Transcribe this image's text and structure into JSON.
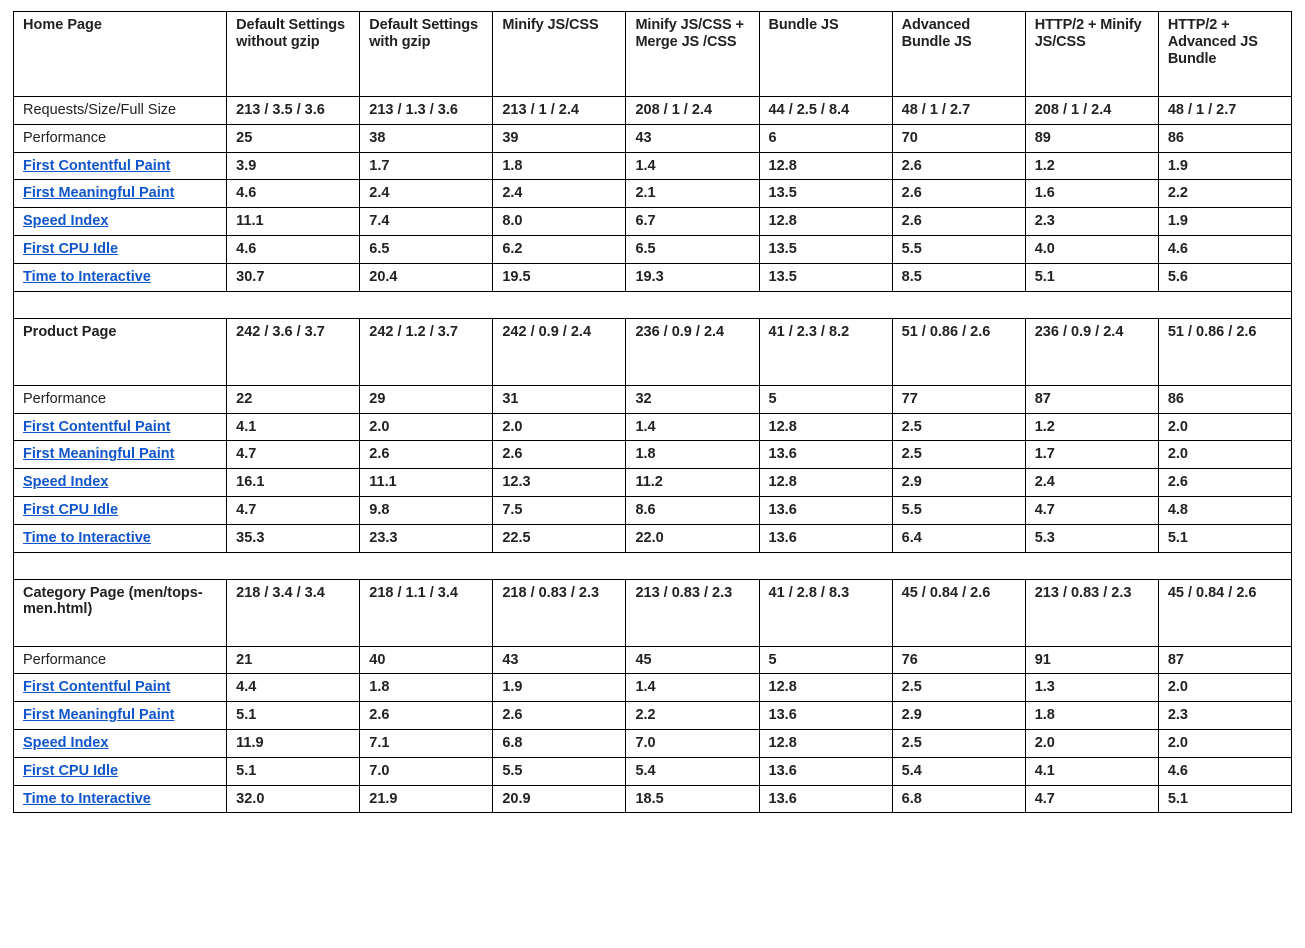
{
  "colors": {
    "good": "#1e7b3c",
    "average": "#e08214",
    "poor": "#b42f28",
    "neutral": "#1a1a1a",
    "link": "#1155cc",
    "border": "#000000"
  },
  "columns": [
    "Default Settings without  gzip",
    "Default Settings with gzip",
    "Minify JS/CSS",
    "Minify JS/CSS + Merge JS /CSS",
    "Bundle JS",
    "Advanced Bundle JS",
    "HTTP/2 + Minify JS/CSS",
    "HTTP/2 + Advanced JS Bundle"
  ],
  "blocks": [
    {
      "title": "Home Page",
      "header_kind": "columns",
      "rows": [
        {
          "label": "Requests/Size/Full Size",
          "label_style": "plain",
          "cells": [
            {
              "text": "213 / 3.5 / 3.6",
              "color": "neutral"
            },
            {
              "text": "213 / 1.3 / 3.6",
              "color": "neutral"
            },
            {
              "text": "213 / 1 / 2.4",
              "color": "neutral"
            },
            {
              "text": "208 / 1 / 2.4",
              "color": "neutral"
            },
            {
              "text": "44 / 2.5 / 8.4",
              "color": "neutral"
            },
            {
              "text": "48 / 1 / 2.7",
              "color": "neutral"
            },
            {
              "text": "208 / 1 / 2.4",
              "color": "neutral"
            },
            {
              "text": "48 / 1 / 2.7",
              "color": "neutral"
            }
          ]
        },
        {
          "label": "Performance",
          "label_style": "plain",
          "cells": [
            {
              "text": "25",
              "color": "neutral"
            },
            {
              "text": "38",
              "color": "neutral"
            },
            {
              "text": "39",
              "color": "neutral"
            },
            {
              "text": "43",
              "color": "neutral"
            },
            {
              "text": "6",
              "color": "neutral"
            },
            {
              "text": "70",
              "color": "neutral"
            },
            {
              "text": "89",
              "color": "neutral"
            },
            {
              "text": "86",
              "color": "neutral"
            }
          ]
        },
        {
          "label": "First Contentful Paint",
          "label_style": "link",
          "cells": [
            {
              "text": "3.9",
              "color": "average"
            },
            {
              "text": "1.7",
              "color": "good"
            },
            {
              "text": "1.8",
              "color": "good"
            },
            {
              "text": "1.4",
              "color": "good"
            },
            {
              "text": "12.8",
              "color": "poor"
            },
            {
              "text": "2.6",
              "color": "average"
            },
            {
              "text": "1.2",
              "color": "good"
            },
            {
              "text": "1.9",
              "color": "good"
            }
          ]
        },
        {
          "label": "First Meaningful Paint",
          "label_style": "link",
          "cells": [
            {
              "text": "4.6",
              "color": "poor"
            },
            {
              "text": "2.4",
              "color": "average"
            },
            {
              "text": "2.4",
              "color": "average"
            },
            {
              "text": "2.1",
              "color": "good"
            },
            {
              "text": "13.5",
              "color": "poor"
            },
            {
              "text": "2.6",
              "color": "average"
            },
            {
              "text": "1.6",
              "color": "good"
            },
            {
              "text": "2.2",
              "color": "good"
            }
          ]
        },
        {
          "label": "Speed Index",
          "label_style": "link",
          "cells": [
            {
              "text": "11.1",
              "color": "poor"
            },
            {
              "text": "7.4",
              "color": "poor"
            },
            {
              "text": "8.0",
              "color": "poor"
            },
            {
              "text": "6.7",
              "color": "poor"
            },
            {
              "text": "12.8",
              "color": "poor"
            },
            {
              "text": "2.6",
              "color": "good"
            },
            {
              "text": "2.3",
              "color": "good"
            },
            {
              "text": "1.9",
              "color": "good"
            }
          ]
        },
        {
          "label": "First CPU Idle",
          "label_style": "link",
          "cells": [
            {
              "text": "4.6",
              "color": "average"
            },
            {
              "text": "6.5",
              "color": "average"
            },
            {
              "text": "6.2",
              "color": "average"
            },
            {
              "text": "6.5",
              "color": "poor"
            },
            {
              "text": "13.5",
              "color": "poor"
            },
            {
              "text": "5.5",
              "color": "average"
            },
            {
              "text": "4.0",
              "color": "average"
            },
            {
              "text": "4.6",
              "color": "average"
            }
          ]
        },
        {
          "label": "Time to Interactive",
          "label_style": "link",
          "cells": [
            {
              "text": "30.7",
              "color": "poor"
            },
            {
              "text": "20.4",
              "color": "poor"
            },
            {
              "text": "19.5",
              "color": "poor"
            },
            {
              "text": "19.3",
              "color": "poor"
            },
            {
              "text": "13.5",
              "color": "poor"
            },
            {
              "text": "8.5",
              "color": "poor"
            },
            {
              "text": "5.1",
              "color": "average"
            },
            {
              "text": "5.6",
              "color": "average"
            }
          ]
        }
      ]
    },
    {
      "title": "Product Page",
      "header_kind": "summary",
      "header_cells": [
        "242 / 3.6 / 3.7",
        "242 / 1.2 / 3.7",
        "242 / 0.9 / 2.4",
        "236 / 0.9 / 2.4",
        "41 / 2.3 / 8.2",
        "51 / 0.86 / 2.6",
        "236 / 0.9 / 2.4",
        "51 / 0.86 / 2.6"
      ],
      "rows": [
        {
          "label": "Performance",
          "label_style": "plain",
          "cells": [
            {
              "text": "22",
              "color": "neutral"
            },
            {
              "text": "29",
              "color": "neutral"
            },
            {
              "text": "31",
              "color": "neutral"
            },
            {
              "text": "32",
              "color": "neutral"
            },
            {
              "text": "5",
              "color": "neutral"
            },
            {
              "text": "77",
              "color": "neutral"
            },
            {
              "text": "87",
              "color": "neutral"
            },
            {
              "text": "86",
              "color": "neutral"
            }
          ]
        },
        {
          "label": "First Contentful Paint",
          "label_style": "link",
          "cells": [
            {
              "text": "4.1",
              "color": "poor"
            },
            {
              "text": "2.0",
              "color": "good"
            },
            {
              "text": "2.0",
              "color": "good"
            },
            {
              "text": "1.4",
              "color": "good"
            },
            {
              "text": "12.8",
              "color": "poor"
            },
            {
              "text": "2.5",
              "color": "average"
            },
            {
              "text": "1.2",
              "color": "good"
            },
            {
              "text": "2.0",
              "color": "good"
            }
          ]
        },
        {
          "label": "First Meaningful Paint",
          "label_style": "link",
          "cells": [
            {
              "text": "4.7",
              "color": "poor"
            },
            {
              "text": "2.6",
              "color": "average"
            },
            {
              "text": "2.6",
              "color": "average"
            },
            {
              "text": "1.8",
              "color": "good"
            },
            {
              "text": "13.6",
              "color": "poor"
            },
            {
              "text": "2.5",
              "color": "average"
            },
            {
              "text": "1.7",
              "color": "good"
            },
            {
              "text": "2.0",
              "color": "good"
            }
          ]
        },
        {
          "label": "Speed Index",
          "label_style": "link",
          "cells": [
            {
              "text": "16.1",
              "color": "poor"
            },
            {
              "text": "11.1",
              "color": "poor"
            },
            {
              "text": "12.3",
              "color": "poor"
            },
            {
              "text": "11.2",
              "color": "poor"
            },
            {
              "text": "12.8",
              "color": "poor"
            },
            {
              "text": "2.9",
              "color": "good"
            },
            {
              "text": "2.4",
              "color": "good"
            },
            {
              "text": "2.6",
              "color": "good"
            }
          ]
        },
        {
          "label": "First CPU Idle",
          "label_style": "link",
          "cells": [
            {
              "text": "4.7",
              "color": "average"
            },
            {
              "text": "9.8",
              "color": "poor"
            },
            {
              "text": "7.5",
              "color": "poor"
            },
            {
              "text": "8.6",
              "color": "poor"
            },
            {
              "text": "13.6",
              "color": "poor"
            },
            {
              "text": "5.5",
              "color": "average"
            },
            {
              "text": "4.7",
              "color": "average"
            },
            {
              "text": "4.8",
              "color": "average"
            }
          ]
        },
        {
          "label": "Time to Interactive",
          "label_style": "link",
          "cells": [
            {
              "text": "35.3",
              "color": "poor"
            },
            {
              "text": "23.3",
              "color": "poor"
            },
            {
              "text": "22.5",
              "color": "poor"
            },
            {
              "text": "22.0",
              "color": "poor"
            },
            {
              "text": "13.6",
              "color": "poor"
            },
            {
              "text": "6.4",
              "color": "average"
            },
            {
              "text": "5.3",
              "color": "average"
            },
            {
              "text": "5.1",
              "color": "average"
            }
          ]
        }
      ]
    },
    {
      "title": "Category Page (men/tops-men.html)",
      "header_kind": "summary",
      "header_cells": [
        "218 / 3.4 / 3.4",
        "218 / 1.1 / 3.4",
        "218 / 0.83 / 2.3",
        "213 / 0.83 / 2.3",
        "41 / 2.8 / 8.3",
        "45 / 0.84 / 2.6",
        "213 / 0.83 / 2.3",
        "45 / 0.84 / 2.6"
      ],
      "rows": [
        {
          "label": "Performance",
          "label_style": "plain",
          "cells": [
            {
              "text": "21",
              "color": "neutral"
            },
            {
              "text": "40",
              "color": "good"
            },
            {
              "text": "43",
              "color": "neutral"
            },
            {
              "text": "45",
              "color": "neutral"
            },
            {
              "text": "5",
              "color": "neutral"
            },
            {
              "text": "76",
              "color": "neutral"
            },
            {
              "text": "91",
              "color": "neutral"
            },
            {
              "text": "87",
              "color": "neutral"
            }
          ]
        },
        {
          "label": "First Contentful Paint",
          "label_style": "link",
          "cells": [
            {
              "text": "4.4",
              "color": "poor"
            },
            {
              "text": "1.8",
              "color": "good"
            },
            {
              "text": "1.9",
              "color": "good"
            },
            {
              "text": "1.4",
              "color": "good"
            },
            {
              "text": "12.8",
              "color": "poor"
            },
            {
              "text": "2.5",
              "color": "average"
            },
            {
              "text": "1.3",
              "color": "good"
            },
            {
              "text": "2.0",
              "color": "good"
            }
          ]
        },
        {
          "label": "First Meaningful Paint",
          "label_style": "link",
          "cells": [
            {
              "text": "5.1",
              "color": "poor"
            },
            {
              "text": "2.6",
              "color": "average"
            },
            {
              "text": "2.6",
              "color": "average"
            },
            {
              "text": "2.2",
              "color": "good"
            },
            {
              "text": "13.6",
              "color": "poor"
            },
            {
              "text": "2.9",
              "color": "average"
            },
            {
              "text": "1.8",
              "color": "good"
            },
            {
              "text": "2.3",
              "color": "good"
            }
          ]
        },
        {
          "label": "Speed Index",
          "label_style": "link",
          "cells": [
            {
              "text": "11.9",
              "color": "poor"
            },
            {
              "text": "7.1",
              "color": "poor"
            },
            {
              "text": "6.8",
              "color": "poor"
            },
            {
              "text": "7.0",
              "color": "poor"
            },
            {
              "text": "12.8",
              "color": "poor"
            },
            {
              "text": "2.5",
              "color": "good"
            },
            {
              "text": "2.0",
              "color": "good"
            },
            {
              "text": "2.0",
              "color": "good"
            }
          ]
        },
        {
          "label": "First CPU Idle",
          "label_style": "link",
          "cells": [
            {
              "text": "5.1",
              "color": "average"
            },
            {
              "text": "7.0",
              "color": "poor"
            },
            {
              "text": "5.5",
              "color": "average"
            },
            {
              "text": "5.4",
              "color": "average"
            },
            {
              "text": "13.6",
              "color": "poor"
            },
            {
              "text": "5.4",
              "color": "average"
            },
            {
              "text": "4.1",
              "color": "average"
            },
            {
              "text": "4.6",
              "color": "average"
            }
          ]
        },
        {
          "label": "Time to Interactive",
          "label_style": "link",
          "cells": [
            {
              "text": "32.0",
              "color": "poor"
            },
            {
              "text": "21.9",
              "color": "poor"
            },
            {
              "text": "20.9",
              "color": "poor"
            },
            {
              "text": "18.5",
              "color": "poor"
            },
            {
              "text": "13.6",
              "color": "poor"
            },
            {
              "text": "6.8",
              "color": "average"
            },
            {
              "text": "4.7",
              "color": "average"
            },
            {
              "text": "5.1",
              "color": "average"
            }
          ]
        }
      ]
    }
  ]
}
